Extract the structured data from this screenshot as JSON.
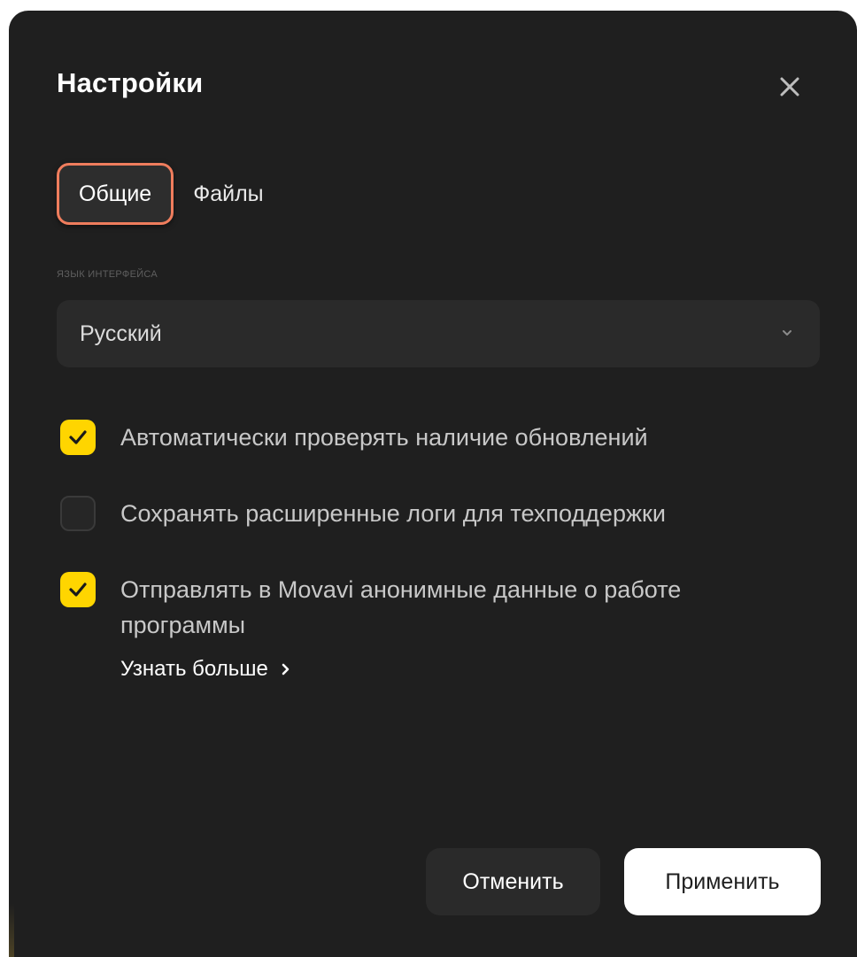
{
  "dialog": {
    "title": "Настройки",
    "close_icon": "close-icon"
  },
  "tabs": [
    {
      "label": "Общие",
      "active": true
    },
    {
      "label": "Файлы",
      "active": false
    }
  ],
  "language": {
    "label": "ЯЗЫК ИНТЕРФЕЙСА",
    "value": "Русский",
    "icon": "chevron-down-icon"
  },
  "options": [
    {
      "label": "Автоматически проверять наличие обновлений",
      "checked": true
    },
    {
      "label": "Сохранять расширенные логи для техподдержки",
      "checked": false
    },
    {
      "label": "Отправлять в Movavi анонимные данные о работе программы",
      "checked": true
    }
  ],
  "learn_more": {
    "label": "Узнать больше",
    "icon": "chevron-right-icon"
  },
  "footer": {
    "cancel_label": "Отменить",
    "apply_label": "Применить"
  },
  "colors": {
    "dialog_bg": "#1f1f1f",
    "accent_check": "#ffd500",
    "tab_highlight": "#ef7d5d",
    "field_bg": "#2a2a2a"
  }
}
